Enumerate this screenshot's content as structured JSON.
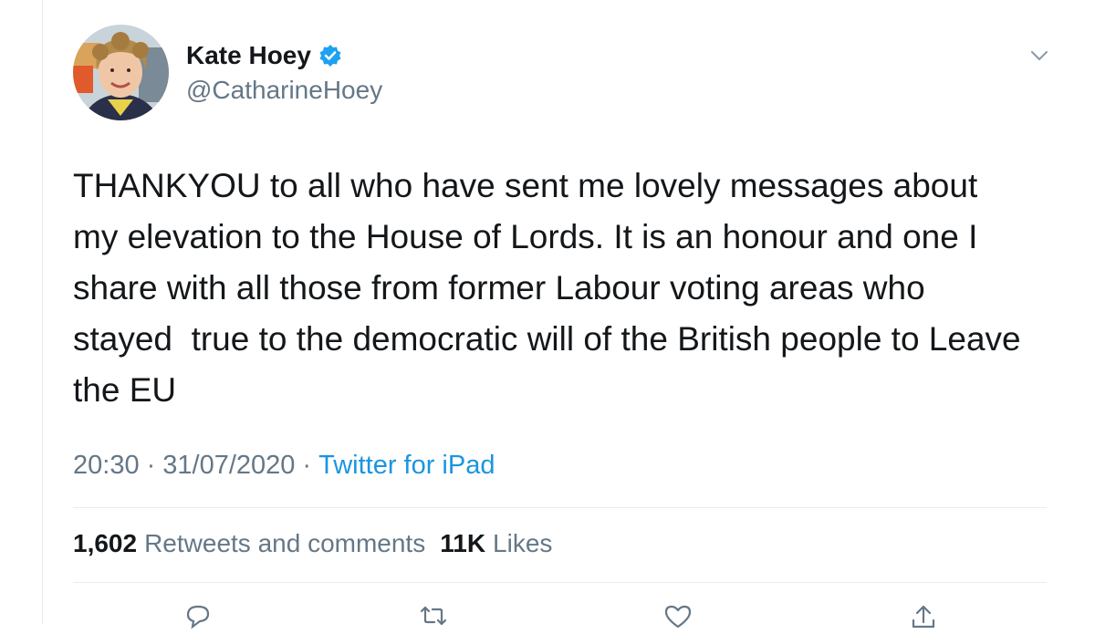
{
  "tweet": {
    "author": {
      "name": "Kate Hoey",
      "handle": "@CatharineHoey",
      "verified_icon": "verified-badge-icon",
      "avatar_icon": "profile-photo"
    },
    "text": "THANKYOU to all who have sent me lovely messages about\nmy elevation to the House of Lords. It is an honour and one I\nshare with all those from former Labour voting areas who\nstayed  true to the democratic will of the British people to Leave\nthe EU",
    "time": "20:30",
    "separator": "·",
    "date": "31/07/2020",
    "source": "Twitter for iPad",
    "stats": {
      "retweets_count": "1,602",
      "retweets_label": "Retweets and comments",
      "likes_count": "11K",
      "likes_label": "Likes"
    },
    "actions": [
      "reply-icon",
      "retweet-icon",
      "like-icon",
      "share-icon"
    ]
  },
  "colors": {
    "text_primary": "#14171a",
    "text_secondary": "#657786",
    "link": "#1b95e0",
    "verified": "#1da1f2",
    "divider": "#e6ecf0"
  }
}
